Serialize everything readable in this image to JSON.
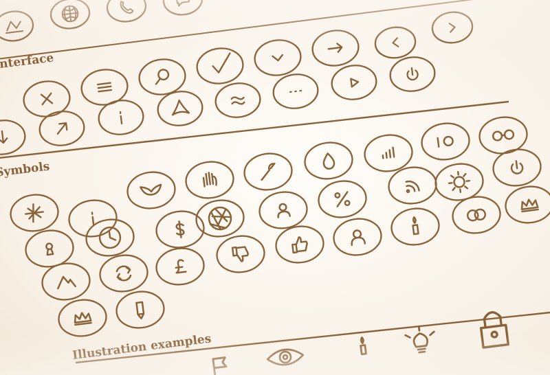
{
  "sections": {
    "interface": "Interface",
    "symbols": "Symbols",
    "illustration": "Illustration examples"
  },
  "colors": {
    "ink": "#8a6239",
    "paper": "#fbf7f1"
  },
  "icon_rows": [
    [
      "map-icon",
      "globe-icon",
      "phone-icon",
      "speech-bubble-icon"
    ],
    [
      "chevron-left-icon",
      "chevron-right-icon"
    ],
    [
      "close-icon",
      "menu-icon",
      "search-icon",
      "checkmark-icon",
      "chevron-down-icon",
      "arrow-right-icon"
    ],
    [
      "power-icon",
      "play-icon",
      "more-icon",
      "approx-icon",
      "pdf-icon",
      "info-icon",
      "arrow-up-right-icon",
      "download-icon"
    ],
    [
      "glasses-icon",
      "toggle-icon",
      "signal-bars-icon",
      "drop-icon",
      "wrench-icon",
      "hand-icon",
      "wings-icon"
    ],
    [
      "power-icon",
      "sun-icon",
      "rss-icon",
      "percent-icon",
      "user-chat-icon",
      "aperture-icon",
      "info-chat-icon",
      "plane-icon"
    ],
    [
      "crown-icon",
      "rings-icon",
      "candle-icon",
      "user-icon",
      "thumbs-up-icon",
      "thumbs-down-icon",
      "dollar-icon",
      "clock-icon",
      "keyhole-icon"
    ],
    [
      "pound-icon",
      "refresh-icon",
      "mountain-icon"
    ],
    [
      "pencil-icon",
      "crown-icon"
    ]
  ],
  "illustration_icons": [
    "flag-icon",
    "eye-icon",
    "candle-icon",
    "lightbulb-icon",
    "lock-icon"
  ]
}
